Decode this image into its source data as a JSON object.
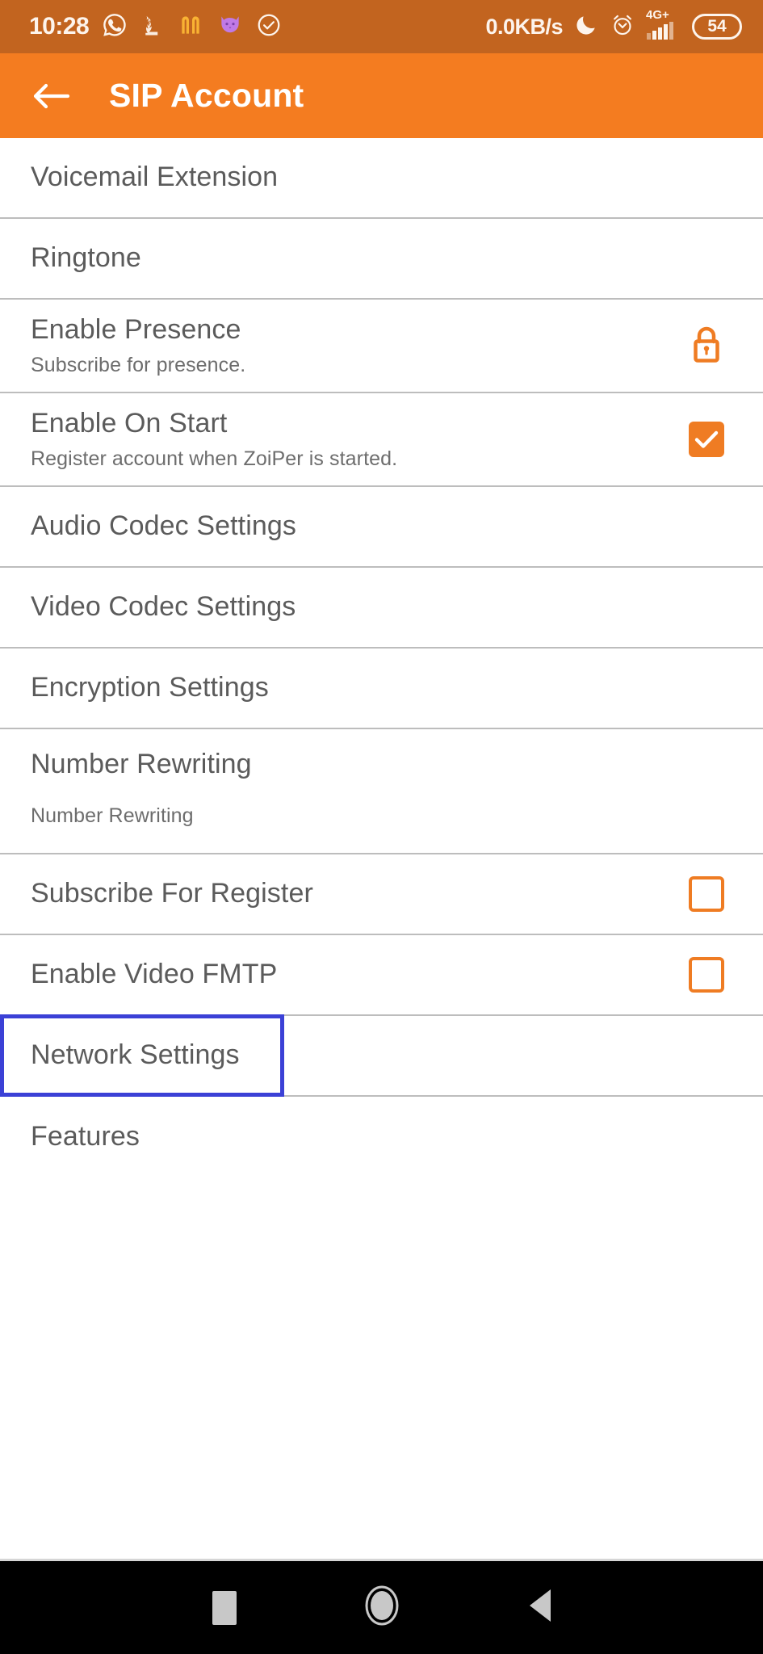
{
  "status_bar": {
    "time": "10:28",
    "network_speed": "0.0KB/s",
    "network_type": "4G+",
    "battery_level": "54",
    "left_icons": [
      "whatsapp-icon",
      "temple-icon",
      "mcdonalds-icon",
      "cat-icon",
      "check-circle-icon"
    ],
    "right_icons": [
      "moon-icon",
      "alarm-icon",
      "signal-icon",
      "battery-icon"
    ],
    "background_color": "#C2641F"
  },
  "app_bar": {
    "back_label": "back-arrow",
    "title": "SIP Account",
    "background_color": "#F47C20",
    "text_color": "#FFFFFF"
  },
  "settings_list": {
    "accent_color": "#EF7C23",
    "focus_color": "#3B41D6",
    "rows": [
      {
        "title": "Voicemail Extension",
        "subtitle": "",
        "accessory": "none"
      },
      {
        "title": "Ringtone",
        "subtitle": "",
        "accessory": "none"
      },
      {
        "title": "Enable Presence",
        "subtitle": "Subscribe for presence.",
        "accessory": "lock"
      },
      {
        "title": "Enable On Start",
        "subtitle": "Register account when ZoiPer is started.",
        "accessory": "checkbox-checked"
      },
      {
        "title": "Audio Codec Settings",
        "subtitle": "",
        "accessory": "none"
      },
      {
        "title": "Video Codec Settings",
        "subtitle": "",
        "accessory": "none"
      },
      {
        "title": "Encryption Settings",
        "subtitle": "",
        "accessory": "none"
      },
      {
        "title": "Number Rewriting",
        "subtitle": "Number Rewriting",
        "accessory": "none"
      },
      {
        "title": "Subscribe For Register",
        "subtitle": "",
        "accessory": "checkbox-unchecked"
      },
      {
        "title": "Enable Video FMTP",
        "subtitle": "",
        "accessory": "checkbox-unchecked"
      },
      {
        "title": "Network Settings",
        "subtitle": "",
        "accessory": "none",
        "focused": true
      },
      {
        "title": "Features",
        "subtitle": "",
        "accessory": "none"
      }
    ]
  },
  "nav_bar": {
    "buttons": [
      "recents-square-button",
      "home-circle-button",
      "back-triangle-button"
    ],
    "background_color": "#000000"
  }
}
